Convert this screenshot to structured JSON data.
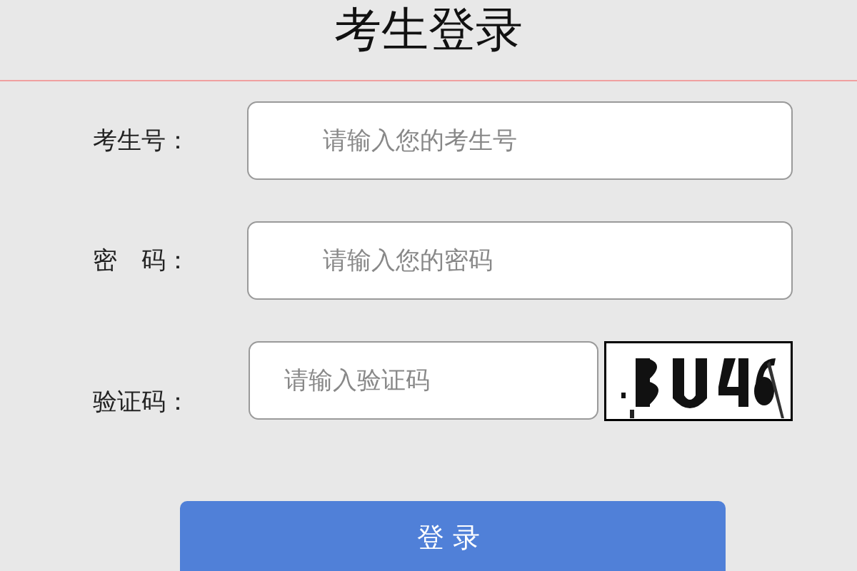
{
  "title": "考生登录",
  "fields": [
    {
      "label": "考生号：",
      "placeholder": "请输入您的考生号",
      "kind": "text"
    },
    {
      "label": "密　码：",
      "placeholder": "请输入您的密码",
      "kind": "password"
    },
    {
      "label": "验证码：",
      "placeholder": "请输入验证码",
      "kind": "captcha"
    }
  ],
  "submit": "登录"
}
